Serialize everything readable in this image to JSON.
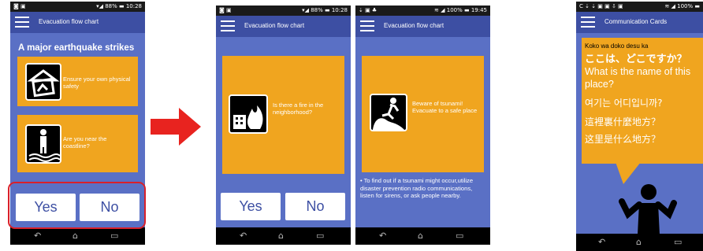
{
  "phones": {
    "p1": {
      "status_left": "◙ ▣",
      "status_right": "▾◢ 88% ▬ 10:28",
      "title": "Evacuation flow chart",
      "heading": "A major earthquake strikes",
      "card1": "Ensure your own physical safety",
      "card1_icon": "collapsed-house-icon",
      "card2": "Are you near the coastline?",
      "card2_icon": "person-at-coast-icon",
      "yes": "Yes",
      "no": "No"
    },
    "p2": {
      "status_left": "◙ ▣",
      "status_right": "▾◢ 88% ▬ 10:28",
      "title": "Evacuation flow chart",
      "card1": "Is there a fire in the neighborhood?",
      "card1_icon": "building-fire-icon",
      "yes": "Yes",
      "no": "No"
    },
    "p3": {
      "status_left": "⇣ ▣ ♣",
      "status_right": "≋ ◢ 100% ▬ 19:45",
      "title": "Evacuation flow chart",
      "card1": "Beware of tsunami! Evacuate to a safe place",
      "card1_icon": "person-running-from-wave-icon",
      "note": "• To find out if a tsunami might occur,utilize disaster prevention radio communications, listen for sirens, or ask people nearby."
    },
    "p4": {
      "status_left": "C ⇣ ⇣ ▣ ▣ ⇩ ▣",
      "status_right": "≋ ◢ 100% ▬",
      "title": "Communication Cards",
      "romaji": "Koko wa doko desu ka",
      "japanese": "ここは、どこですか？",
      "english": "What is the name of this place?",
      "korean": "여기는 어디입니까?",
      "chinese_trad": "這裡裏什麼地方？",
      "chinese_simp": "这里是什么地方？",
      "figure_icon": "person-shrugging-icon"
    }
  },
  "nav": {
    "back": "↶",
    "home": "⌂",
    "recent": "▭"
  },
  "colors": {
    "appbar": "#3d4fa3",
    "screen": "#5a70c5",
    "card": "#f0a51f",
    "arrow": "#e8231f",
    "highlight": "#d9202a"
  }
}
